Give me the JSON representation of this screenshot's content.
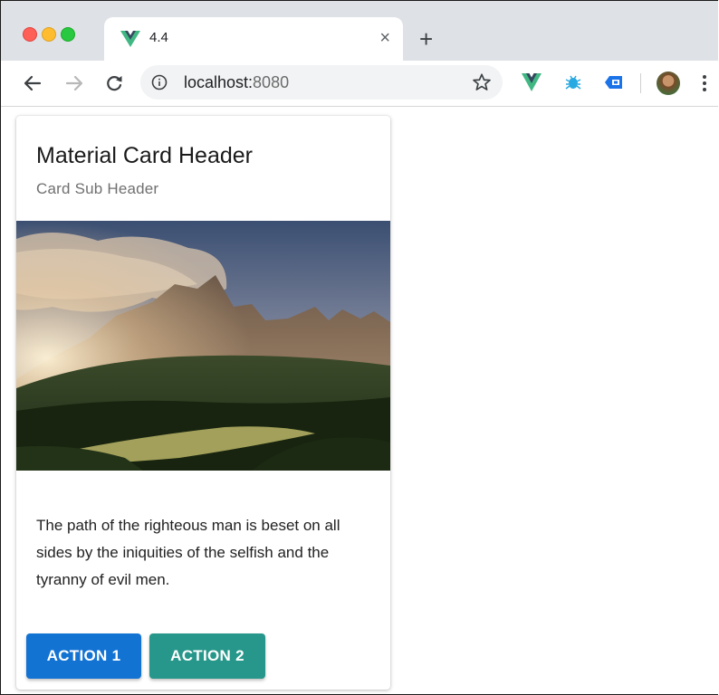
{
  "browser": {
    "tab_title": "4.4",
    "tab_close": "×",
    "new_tab": "+",
    "url_host": "localhost:",
    "url_port": "8080",
    "icons": [
      "vue-favicon-icon",
      "close-icon",
      "plus-icon",
      "back-arrow-icon",
      "forward-arrow-icon",
      "reload-icon",
      "info-icon",
      "star-icon",
      "vue-extension-icon",
      "bug-extension-icon",
      "tag-extension-icon",
      "avatar",
      "kebab-menu-icon"
    ],
    "colors": {
      "vue_green": "#41b883",
      "vue_dark": "#35495e",
      "tab_strip": "#dee1e6"
    }
  },
  "card": {
    "title": "Material Card Header",
    "subtitle": "Card Sub Header",
    "image_alt": "mountain landscape",
    "text": "The path of the righteous man is beset on all sides by the iniquities of the selfish and the tyranny of evil men.",
    "actions": [
      {
        "label": "ACTION 1",
        "color": "#1373d3"
      },
      {
        "label": "ACTION 2",
        "color": "#26978a"
      }
    ]
  }
}
